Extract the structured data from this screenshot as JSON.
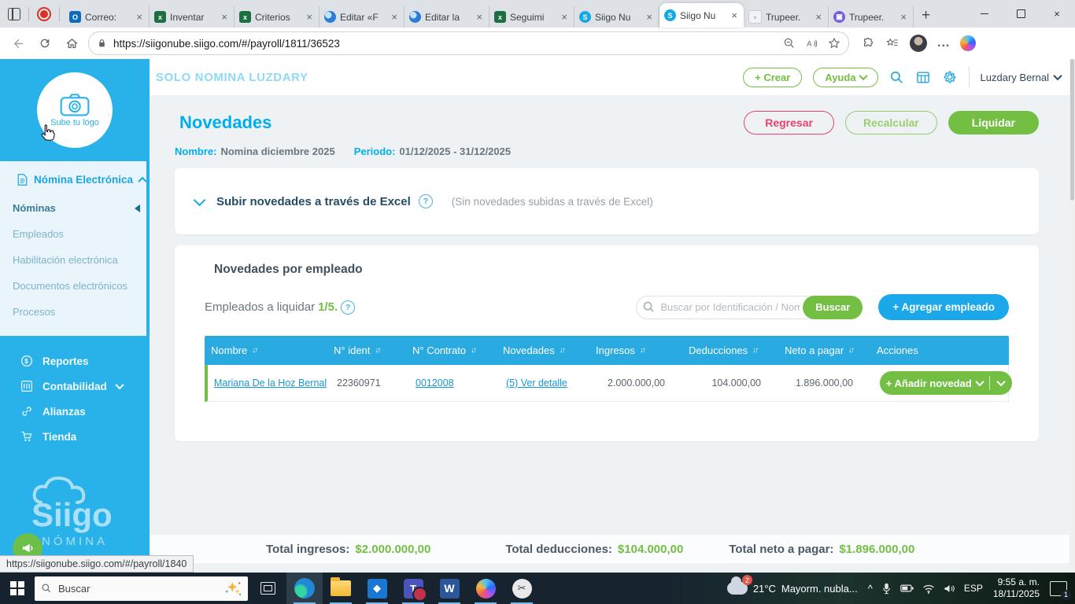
{
  "glyphs": {
    "close": "×",
    "new_tab": "+",
    "sort": "↓↑",
    "help": "?",
    "dots": "···",
    "collapse": "❮",
    "ellipsis_menu": "...",
    "hidden_icons": "^"
  },
  "browser": {
    "tabs": [
      {
        "title": "Correo:"
      },
      {
        "title": "Inventar"
      },
      {
        "title": "Criterios"
      },
      {
        "title": "Editar «F"
      },
      {
        "title": "Editar la"
      },
      {
        "title": "Seguimi"
      },
      {
        "title": "Siigo Nu"
      },
      {
        "title": "Siigo Nu"
      },
      {
        "title": "Trupeer."
      },
      {
        "title": "Trupeer."
      }
    ],
    "url": "https://siigonube.siigo.com/#/payroll/1811/36523"
  },
  "sidebar": {
    "upload_logo": "Sube tu logo",
    "section_title": "Nómina Electrónica",
    "items": [
      {
        "label": "Nóminas"
      },
      {
        "label": "Empleados"
      },
      {
        "label": "Habilitación electrónica"
      },
      {
        "label": "Documentos electrónicos"
      },
      {
        "label": "Procesos"
      }
    ],
    "blue_items": [
      {
        "label": "Reportes"
      },
      {
        "label": "Contabilidad"
      },
      {
        "label": "Alianzas"
      },
      {
        "label": "Tienda"
      }
    ],
    "logo_word": "Siigo",
    "logo_sub": "NÓMINA"
  },
  "header": {
    "company": "SOLO NOMINA LUZDARY",
    "crear": "+ Crear",
    "ayuda": "Ayuda",
    "user": "Luzdary Bernal"
  },
  "page": {
    "title": "Novedades",
    "regresar": "Regresar",
    "recalcular": "Recalcular",
    "liquidar": "Liquidar",
    "nombre_label": "Nombre:",
    "nombre_value": "Nomina diciembre 2025",
    "periodo_label": "Periodo:",
    "periodo_value": "01/12/2025 - 31/12/2025"
  },
  "excel_card": {
    "title": "Subir novedades a través de Excel",
    "note": "(Sin novedades subidas a través de Excel)"
  },
  "employees": {
    "section_title": "Novedades por empleado",
    "liquidar_label": "Empleados a liquidar",
    "liquidar_count": "1/5.",
    "search_placeholder": "Buscar por Identificación / Nombre / Conc",
    "buscar": "Buscar",
    "agregar": "+ Agregar empleado"
  },
  "table": {
    "headers": [
      "Nombre",
      "N° ident",
      "N° Contrato",
      "Novedades",
      "Ingresos",
      "Deducciones",
      "Neto a pagar",
      "Acciones"
    ],
    "row": {
      "nombre": "Mariana De la Hoz Bernal",
      "ident": "22360971",
      "contrato": "0012008",
      "novedades": "(5) Ver detalle",
      "ingresos": "2.000.000,00",
      "deducciones": "104.000,00",
      "neto": "1.896.000,00",
      "accion": "+ Añadir novedad"
    }
  },
  "totals": {
    "ingresos_label": "Total ingresos:",
    "ingresos": "$2.000.000,00",
    "deducciones_label": "Total deducciones:",
    "deducciones": "$104.000,00",
    "neto_label": "Total neto a pagar:",
    "neto": "$1.896.000,00"
  },
  "status_url": "https://siigonube.siigo.com/#/payroll/1840",
  "taskbar": {
    "search_label": "Buscar",
    "temp": "21°C",
    "weather_desc": "Mayorm. nubla...",
    "weather_badge": "2",
    "lang": "ESP",
    "time": "9:55 a. m.",
    "date": "18/11/2025",
    "notif_count": "1",
    "teams_letter": "T",
    "word_letter": "W",
    "dev_glyph": "◆",
    "snip_glyph": "✂"
  },
  "colors": {
    "siigo_blue": "#29b2ea",
    "table_header_blue": "#29abe2",
    "green": "#72bf44",
    "red": "#e8436e",
    "link_blue": "#1798d5",
    "title_blue": "#00aeef"
  }
}
